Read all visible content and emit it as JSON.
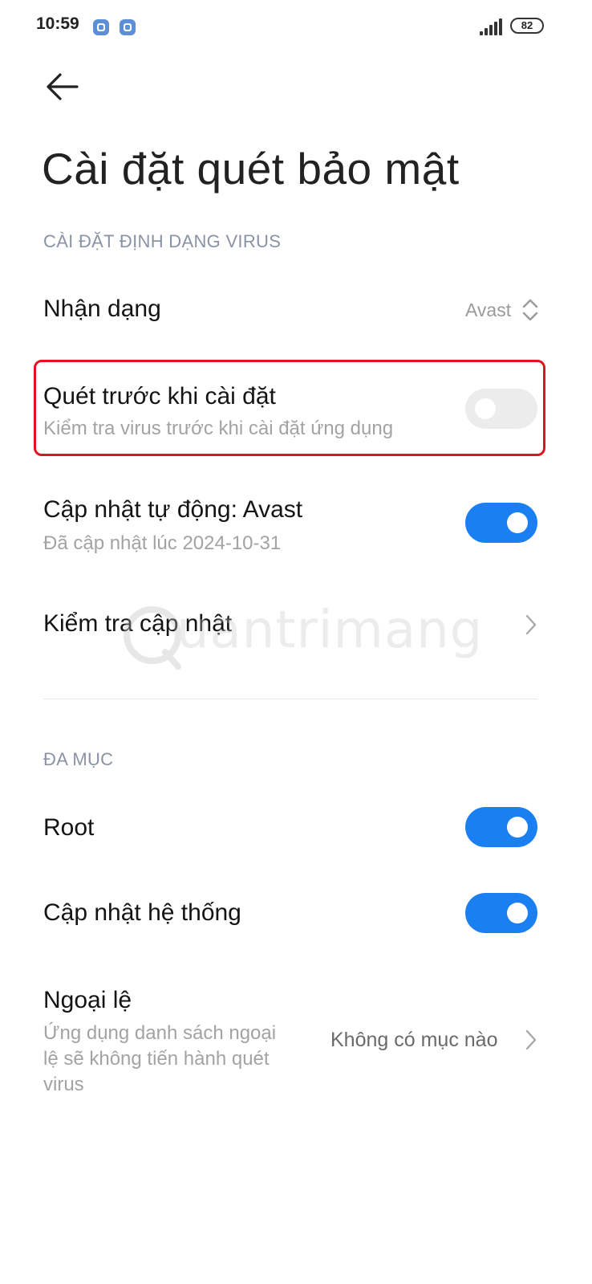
{
  "status_bar": {
    "time": "10:59",
    "battery": "82",
    "icons": [
      "notification-app-icon",
      "notification-app-icon",
      "signal-icon",
      "battery-icon"
    ]
  },
  "header": {
    "back_icon": "arrow-left-icon",
    "title": "Cài đặt quét bảo mật"
  },
  "section_virus": {
    "header": "CÀI ĐẶT ĐỊNH DẠNG VIRUS",
    "identify": {
      "title": "Nhận dạng",
      "value": "Avast",
      "icon": "up-down-chevron-icon"
    },
    "scan_before_install": {
      "title": "Quét trước khi cài đặt",
      "subtitle": "Kiểm tra virus trước khi cài đặt ứng dụng",
      "enabled": false
    },
    "auto_update": {
      "title": "Cập nhật tự động: Avast",
      "subtitle": "Đã cập nhật lúc 2024-10-31",
      "enabled": true
    },
    "check_update": {
      "title": "Kiểm tra cập nhật",
      "icon": "chevron-right-icon"
    }
  },
  "section_misc": {
    "header": "ĐA MỤC",
    "root": {
      "title": "Root",
      "enabled": true
    },
    "system_update": {
      "title": "Cập nhật hệ thống",
      "enabled": true
    },
    "exceptions": {
      "title": "Ngoại lệ",
      "subtitle_lines": [
        "Ứng dụng danh sách ngoại",
        "lệ sẽ không tiến hành quét",
        "virus"
      ],
      "value": "Không có mục nào",
      "icon": "chevron-right-icon"
    }
  },
  "watermark": {
    "text": "uantrimang"
  },
  "colors": {
    "accent": "#1a7ff0",
    "highlight": "#e0141e",
    "toggle_off": "#ececec",
    "section_header": "#8a93a6"
  }
}
